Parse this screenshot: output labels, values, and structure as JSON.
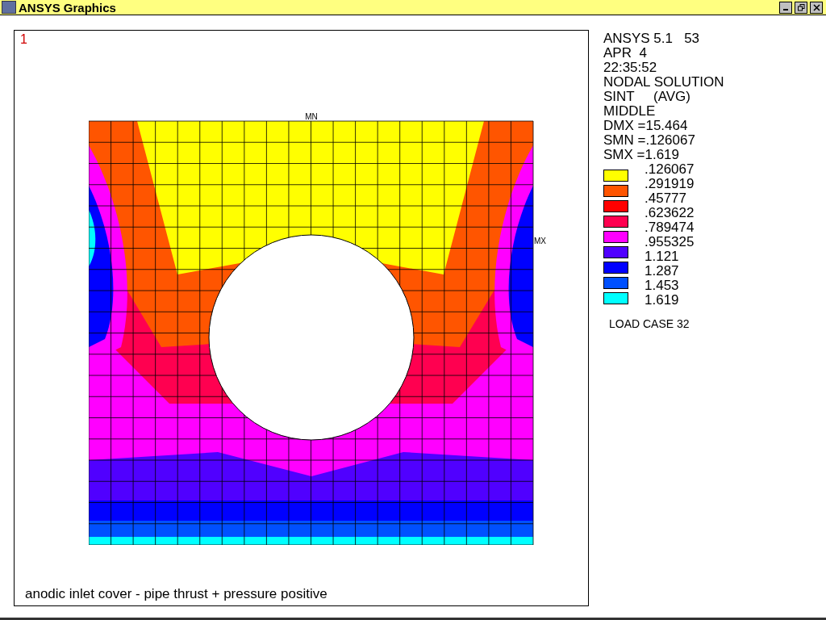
{
  "window": {
    "title": "ANSYS Graphics"
  },
  "plot": {
    "window_number": "1",
    "min_label": "MN",
    "max_label": "MX",
    "caption": "anodic inlet cover - pipe thrust + pressure positive"
  },
  "info": [
    "ANSYS 5.1   53",
    "APR  4",
    "22:35:52",
    "NODAL SOLUTION",
    "SINT     (AVG)",
    "MIDDLE",
    "DMX =15.464",
    "SMN =.126067",
    "SMX =1.619"
  ],
  "legend": {
    "bands": [
      {
        "color": "#ffff00"
      },
      {
        "color": "#ff5500"
      },
      {
        "color": "#ff0000"
      },
      {
        "color": "#ff0050"
      },
      {
        "color": "#ff00ff"
      },
      {
        "color": "#5000ff"
      },
      {
        "color": "#0000ff"
      },
      {
        "color": "#0050ff"
      },
      {
        "color": "#00ffff"
      }
    ],
    "values": [
      ".126067",
      ".291919",
      ".45777",
      ".623622",
      ".789474",
      ".955325",
      "1.121",
      "1.287",
      "1.453",
      "1.619"
    ]
  },
  "load_case": "LOAD CASE 32"
}
